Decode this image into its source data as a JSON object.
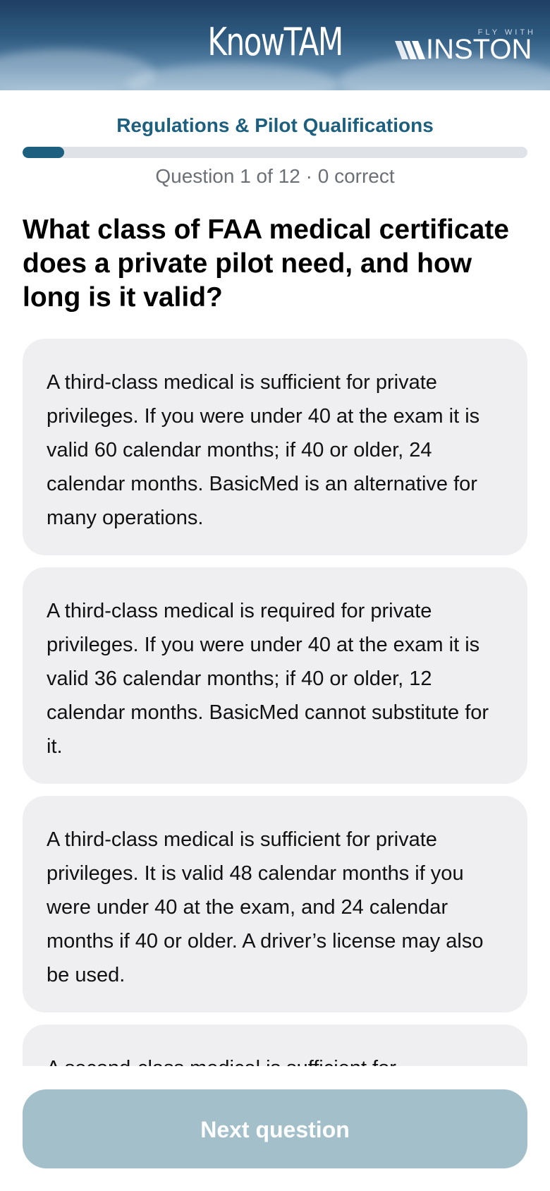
{
  "header": {
    "app_name": "KnowTAM",
    "partner_tagline": "FLY WITH",
    "partner_name": "INSTON"
  },
  "quiz": {
    "category": "Regulations & Pilot Qualifications",
    "progress_fraction": 0.083,
    "counter": "Question 1 of 12 · 0 correct",
    "question": "What class of FAA medical certificate does a private pilot need, and how long is it valid?"
  },
  "answers": [
    {
      "text": "A third-class medical is sufficient for private privileges. If you were under 40 at the exam it is valid 60 calendar months; if 40 or older, 24 calendar months. BasicMed is an alternative for many operations."
    },
    {
      "text": "A third-class medical is required for private privileges. If you were under 40 at the exam it is valid 36 calendar months; if 40 or older, 12 calendar months. BasicMed cannot substitute for it."
    },
    {
      "text": "A third-class medical is sufficient for private privileges. It is valid 48 calendar months if you were under 40 at the exam, and 24 calendar months if 40 or older. A driver’s license may also be used."
    },
    {
      "text": "A second-class medical is sufficient for"
    }
  ],
  "footer": {
    "next_label": "Next question"
  },
  "colors": {
    "accent": "#1c5f7e",
    "answer_bg": "#efeff1",
    "button_disabled": "#a3c0ca"
  }
}
